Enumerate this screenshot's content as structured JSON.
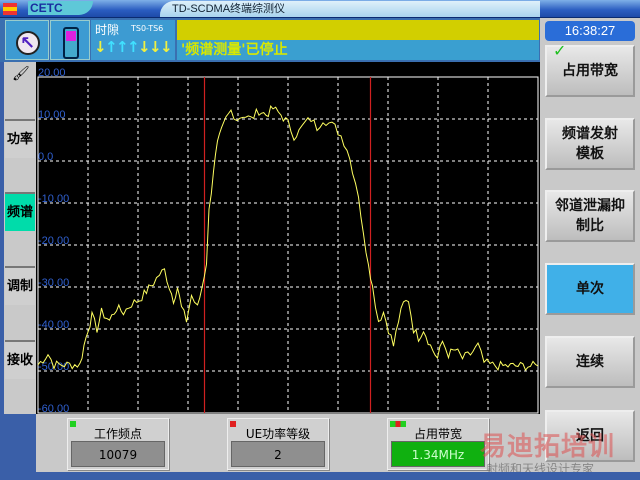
{
  "window": {
    "brand": "CETC",
    "title": "TD-SCDMA终端综测仪"
  },
  "top": {
    "slot_label": "时隙",
    "slot_range": "TS0-TS6",
    "slot_dirs": [
      "down",
      "up",
      "up",
      "up",
      "down",
      "down",
      "down"
    ],
    "status": "'频谱测量'已停止"
  },
  "clock": "16:38:27",
  "right_buttons": [
    {
      "label": "占用带宽",
      "checked": true
    },
    {
      "label": "频谱发射模板"
    },
    {
      "label": "邻道泄漏抑制比"
    },
    {
      "label": "单次",
      "active": true
    },
    {
      "label": "连续"
    },
    {
      "label": "返回"
    }
  ],
  "left_tabs": [
    {
      "label": "功率"
    },
    {
      "label": "频谱",
      "active": true
    },
    {
      "label": "调制"
    },
    {
      "label": "接收"
    }
  ],
  "cards": [
    {
      "label": "工作频点",
      "value": "10079"
    },
    {
      "label": "UE功率等级",
      "value": "2"
    },
    {
      "label": "占用带宽",
      "value": "1.34MHz"
    }
  ],
  "watermark": {
    "line1": "易迪拓培训",
    "line2": "射频和天线设计专家"
  },
  "colors": {
    "trace": "#ffff60",
    "marker": "#d02020",
    "grid": "#ffffff",
    "axis_label": "#3060d0",
    "active_tab": "#00dcaa",
    "result_ok": "#10b010"
  },
  "chart_data": {
    "type": "line",
    "ylim": [
      -60,
      20
    ],
    "xlim": [
      0,
      100
    ],
    "yticks": [
      "20.00",
      "10.00",
      "0.0",
      "-10.00",
      "-20.00",
      "-30.00",
      "-40.00",
      "-50.00",
      "-60.00"
    ],
    "ytick_values": [
      20,
      10,
      0,
      -10,
      -20,
      -30,
      -40,
      -50,
      -60
    ],
    "markers_x": [
      33.3,
      66.5
    ],
    "grid": true,
    "points": [
      [
        0,
        -48.5
      ],
      [
        2,
        -46
      ],
      [
        3.2,
        -48.5
      ],
      [
        8.4,
        -48.5
      ],
      [
        9.2,
        -44
      ],
      [
        10,
        -40
      ],
      [
        10.8,
        -37
      ],
      [
        11.8,
        -40
      ],
      [
        12.7,
        -36
      ],
      [
        14.3,
        -38
      ],
      [
        15.7,
        -35
      ],
      [
        17.1,
        -36
      ],
      [
        18.7,
        -34
      ],
      [
        20.3,
        -33
      ],
      [
        21.7,
        -31
      ],
      [
        23.1,
        -29
      ],
      [
        24.3,
        -27
      ],
      [
        25.3,
        -26
      ],
      [
        26.3,
        -30
      ],
      [
        27.1,
        -33
      ],
      [
        27.9,
        -30
      ],
      [
        28.7,
        -35
      ],
      [
        29.7,
        -38
      ],
      [
        30.7,
        -32
      ],
      [
        31.9,
        -35
      ],
      [
        32.8,
        -30
      ],
      [
        33.7,
        -24
      ],
      [
        34.2,
        -12
      ],
      [
        35.1,
        -2
      ],
      [
        35.9,
        4
      ],
      [
        36.7,
        7
      ],
      [
        37.6,
        10
      ],
      [
        38.6,
        12
      ],
      [
        39.8,
        10
      ],
      [
        41,
        11
      ],
      [
        42.6,
        10
      ],
      [
        44.2,
        12
      ],
      [
        45.6,
        11
      ],
      [
        47,
        12.5
      ],
      [
        48.6,
        11
      ],
      [
        50,
        9
      ],
      [
        51.2,
        6
      ],
      [
        52.2,
        7
      ],
      [
        53.4,
        9
      ],
      [
        54.6,
        10
      ],
      [
        55.8,
        8
      ],
      [
        57,
        10
      ],
      [
        58.2,
        9
      ],
      [
        59.4,
        8
      ],
      [
        60.6,
        6
      ],
      [
        61.8,
        3
      ],
      [
        62.9,
        -2
      ],
      [
        64.1,
        -8
      ],
      [
        65.1,
        -18
      ],
      [
        66.1,
        -24
      ],
      [
        66.9,
        -30
      ],
      [
        68.1,
        -38
      ],
      [
        69.1,
        -36
      ],
      [
        70.1,
        -40
      ],
      [
        71.1,
        -44
      ],
      [
        72.1,
        -38
      ],
      [
        73.1,
        -34
      ],
      [
        74.1,
        -33
      ],
      [
        75.1,
        -40
      ],
      [
        76.1,
        -42
      ],
      [
        77.1,
        -40
      ],
      [
        78.5,
        -44
      ],
      [
        79.9,
        -47
      ],
      [
        80.9,
        -43
      ],
      [
        82.1,
        -46
      ],
      [
        83.5,
        -45
      ],
      [
        84.9,
        -47
      ],
      [
        86.5,
        -46
      ],
      [
        88,
        -44
      ],
      [
        89.2,
        -48
      ],
      [
        90.4,
        -48.5
      ],
      [
        92,
        -48.8
      ],
      [
        100,
        -48.8
      ]
    ]
  }
}
